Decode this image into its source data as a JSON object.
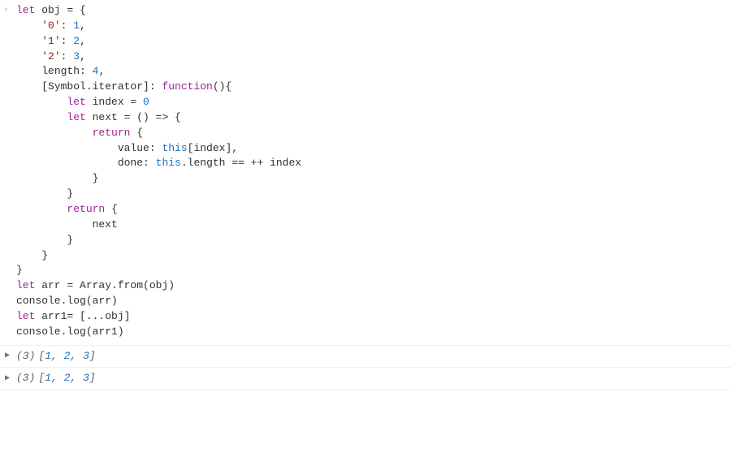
{
  "prompt_glyph": "›",
  "expand_glyph": "▶",
  "code": {
    "l01_let": "let",
    "l01_rest": " obj = {",
    "l02_indent": "    ",
    "l02_str": "'0'",
    "l02_rest": ": ",
    "l02_num": "1",
    "l02_comma": ",",
    "l03_str": "'1'",
    "l03_num": "2",
    "l04_str": "'2'",
    "l04_num": "3",
    "l05_key": "length",
    "l05_num": "4",
    "l06_open": "[Symbol.iterator]: ",
    "l06_fn": "function",
    "l06_close": "(){",
    "l07_let": "let",
    "l07_rest": " index = ",
    "l07_num": "0",
    "l08_let": "let",
    "l08_rest": " next = () => {",
    "l09_ret": "return",
    "l09_rest": " {",
    "l10_key": "value: ",
    "l10_this": "this",
    "l10_rest": "[index],",
    "l11_key": "done: ",
    "l11_this": "this",
    "l11_rest": ".length == ++ index",
    "l12": "}",
    "l13": "}",
    "l14_ret": "return",
    "l14_rest": " {",
    "l15": "next",
    "l16": "}",
    "l17": "}",
    "l18": "}",
    "l19_let": "let",
    "l19_rest": " arr = Array.from(obj)",
    "l20": "console.log(arr)",
    "l21_let": "let",
    "l21_rest": " arr1= [...obj]",
    "l22": "console.log(arr1)"
  },
  "outputs": [
    {
      "len": "(3)",
      "open": " [",
      "v1": "1",
      "sep": ", ",
      "v2": "2",
      "v3": "3",
      "close": "]"
    },
    {
      "len": "(3)",
      "open": " [",
      "v1": "1",
      "sep": ", ",
      "v2": "2",
      "v3": "3",
      "close": "]"
    }
  ],
  "chart_data": {
    "type": "table",
    "title": "Console output arrays",
    "series": [
      {
        "name": "arr",
        "values": [
          1,
          2,
          3
        ]
      },
      {
        "name": "arr1",
        "values": [
          1,
          2,
          3
        ]
      }
    ]
  }
}
